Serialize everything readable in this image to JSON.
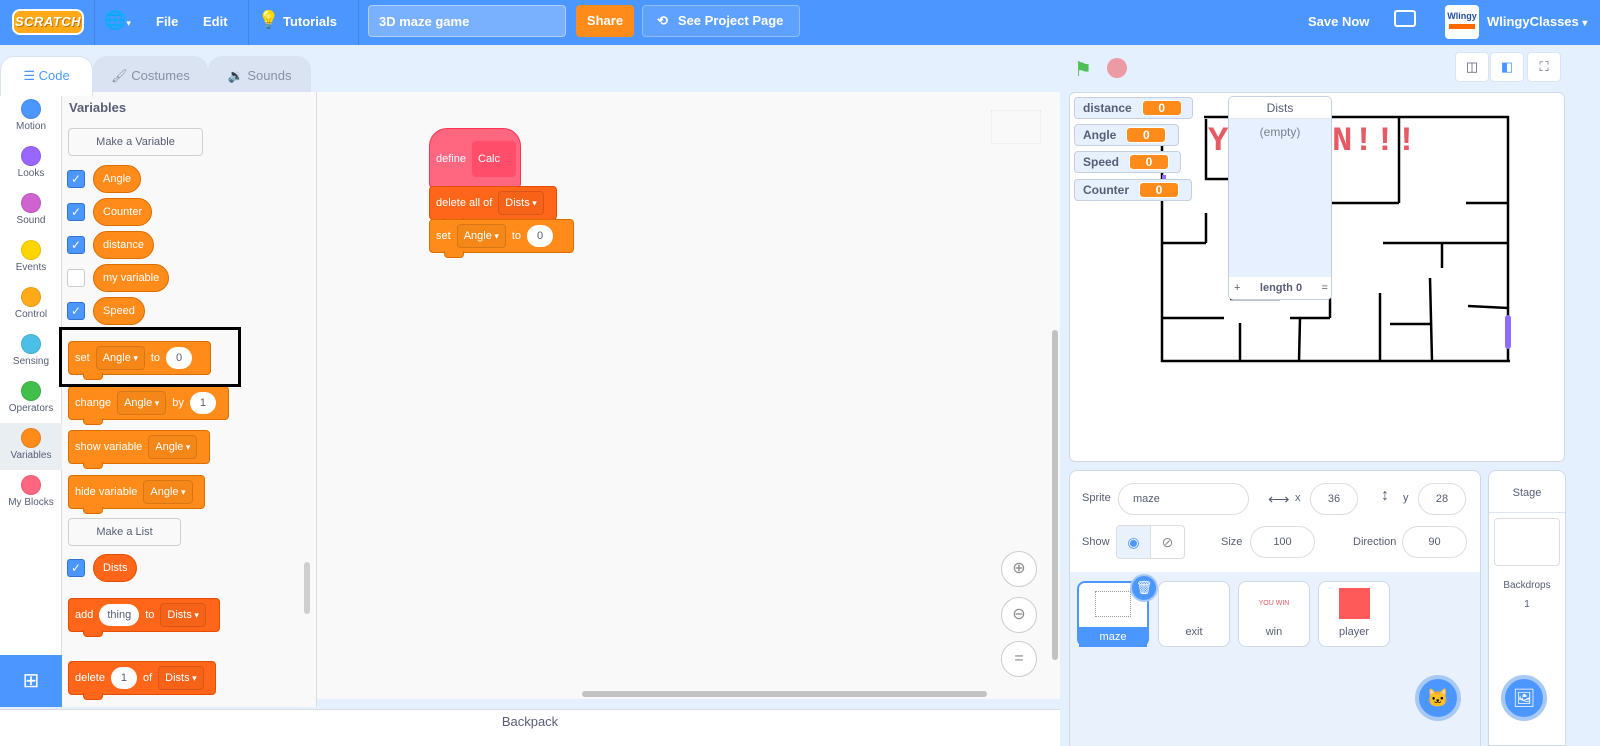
{
  "menubar": {
    "logo": "SCRATCH",
    "file": "File",
    "edit": "Edit",
    "tutorials": "Tutorials",
    "project_title": "3D maze game",
    "share": "Share",
    "see_project_page": "See Project Page",
    "save_now": "Save Now",
    "username": "WlingyClasses",
    "avatar_text": "Wlingy"
  },
  "tabs": [
    {
      "label": "Code",
      "active": true
    },
    {
      "label": "Costumes",
      "active": false
    },
    {
      "label": "Sounds",
      "active": false
    }
  ],
  "categories": [
    {
      "label": "Motion",
      "color": "#4c97ff"
    },
    {
      "label": "Looks",
      "color": "#9966ff"
    },
    {
      "label": "Sound",
      "color": "#cf63cf"
    },
    {
      "label": "Events",
      "color": "#ffd500"
    },
    {
      "label": "Control",
      "color": "#ffab19"
    },
    {
      "label": "Sensing",
      "color": "#4cbfe6"
    },
    {
      "label": "Operators",
      "color": "#40bf4a"
    },
    {
      "label": "Variables",
      "color": "#ff8c1a",
      "selected": true
    },
    {
      "label": "My Blocks",
      "color": "#ff6680"
    }
  ],
  "palette": {
    "heading": "Variables",
    "make_variable": "Make a Variable",
    "variables": [
      {
        "name": "Angle",
        "checked": true
      },
      {
        "name": "Counter",
        "checked": true
      },
      {
        "name": "distance",
        "checked": true
      },
      {
        "name": "my variable",
        "checked": false
      },
      {
        "name": "Speed",
        "checked": true
      }
    ],
    "set_block": {
      "verb": "set",
      "var": "Angle",
      "to": "to",
      "value": "0"
    },
    "change_block": {
      "verb": "change",
      "var": "Angle",
      "by": "by",
      "value": "1"
    },
    "show_block": {
      "verb": "show variable",
      "var": "Angle"
    },
    "hide_block": {
      "verb": "hide variable",
      "var": "Angle"
    },
    "make_list": "Make a List",
    "lists": [
      {
        "name": "Dists",
        "checked": true
      }
    ],
    "add_block": {
      "verb": "add",
      "value": "thing",
      "to": "to",
      "list": "Dists"
    },
    "delete_block": {
      "verb": "delete",
      "value": "1",
      "of": "of",
      "list": "Dists"
    }
  },
  "script": {
    "define": "define",
    "proc_name": "Calc",
    "delete_all": "delete all of",
    "delete_all_list": "Dists",
    "set": "set",
    "set_var": "Angle",
    "to": "to",
    "set_value": "0"
  },
  "zoom_controls": {
    "zoom_in": "+",
    "zoom_out": "−",
    "reset": "="
  },
  "backpack": "Backpack",
  "stage": {
    "monitors": [
      {
        "name": "distance",
        "value": "0"
      },
      {
        "name": "Angle",
        "value": "0"
      },
      {
        "name": "Speed",
        "value": "0"
      },
      {
        "name": "Counter",
        "value": "0"
      }
    ],
    "list_monitor": {
      "title": "Dists",
      "empty_text": "(empty)",
      "add": "+",
      "length_label": "length 0",
      "resize": "="
    },
    "banner_text_left": "Y",
    "banner_text_right": "N!!!"
  },
  "sprite_info": {
    "sprite_label": "Sprite",
    "sprite_name": "maze",
    "x_label": "x",
    "x": "36",
    "y_label": "y",
    "y": "28",
    "show_label": "Show",
    "size_label": "Size",
    "size": "100",
    "direction_label": "Direction",
    "direction": "90"
  },
  "sprites": [
    {
      "name": "maze",
      "selected": true
    },
    {
      "name": "exit",
      "selected": false
    },
    {
      "name": "win",
      "selected": false,
      "thumb_text": "YOU WIN"
    },
    {
      "name": "player",
      "selected": false
    }
  ],
  "stage_pane": {
    "title": "Stage",
    "backdrops_label": "Backdrops",
    "backdrops_count": "1"
  }
}
